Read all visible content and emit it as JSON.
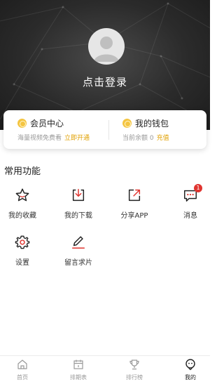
{
  "header": {
    "login_label": "点击登录"
  },
  "member_card": {
    "vip": {
      "title": "会员中心",
      "subtitle": "海量视频免费看",
      "action": "立即开通"
    },
    "wallet": {
      "title": "我的钱包",
      "subtitle": "当前余额 0",
      "action": "充值"
    }
  },
  "functions": {
    "section_title": "常用功能",
    "items": [
      {
        "label": "我的收藏",
        "icon": "star-icon"
      },
      {
        "label": "我的下载",
        "icon": "download-icon"
      },
      {
        "label": "分享APP",
        "icon": "share-icon"
      },
      {
        "label": "消息",
        "icon": "message-icon",
        "badge": "1"
      },
      {
        "label": "设置",
        "icon": "gear-icon"
      },
      {
        "label": "留言求片",
        "icon": "edit-icon"
      }
    ]
  },
  "tabbar": {
    "items": [
      {
        "label": "首页",
        "icon": "home-icon"
      },
      {
        "label": "排期表",
        "icon": "calendar-icon"
      },
      {
        "label": "排行榜",
        "icon": "trophy-icon"
      },
      {
        "label": "我的",
        "icon": "profile-icon",
        "active": true
      }
    ]
  },
  "colors": {
    "accent": "#e0a000",
    "badge": "#e0342f",
    "header_bg": "#2b2b2b"
  }
}
